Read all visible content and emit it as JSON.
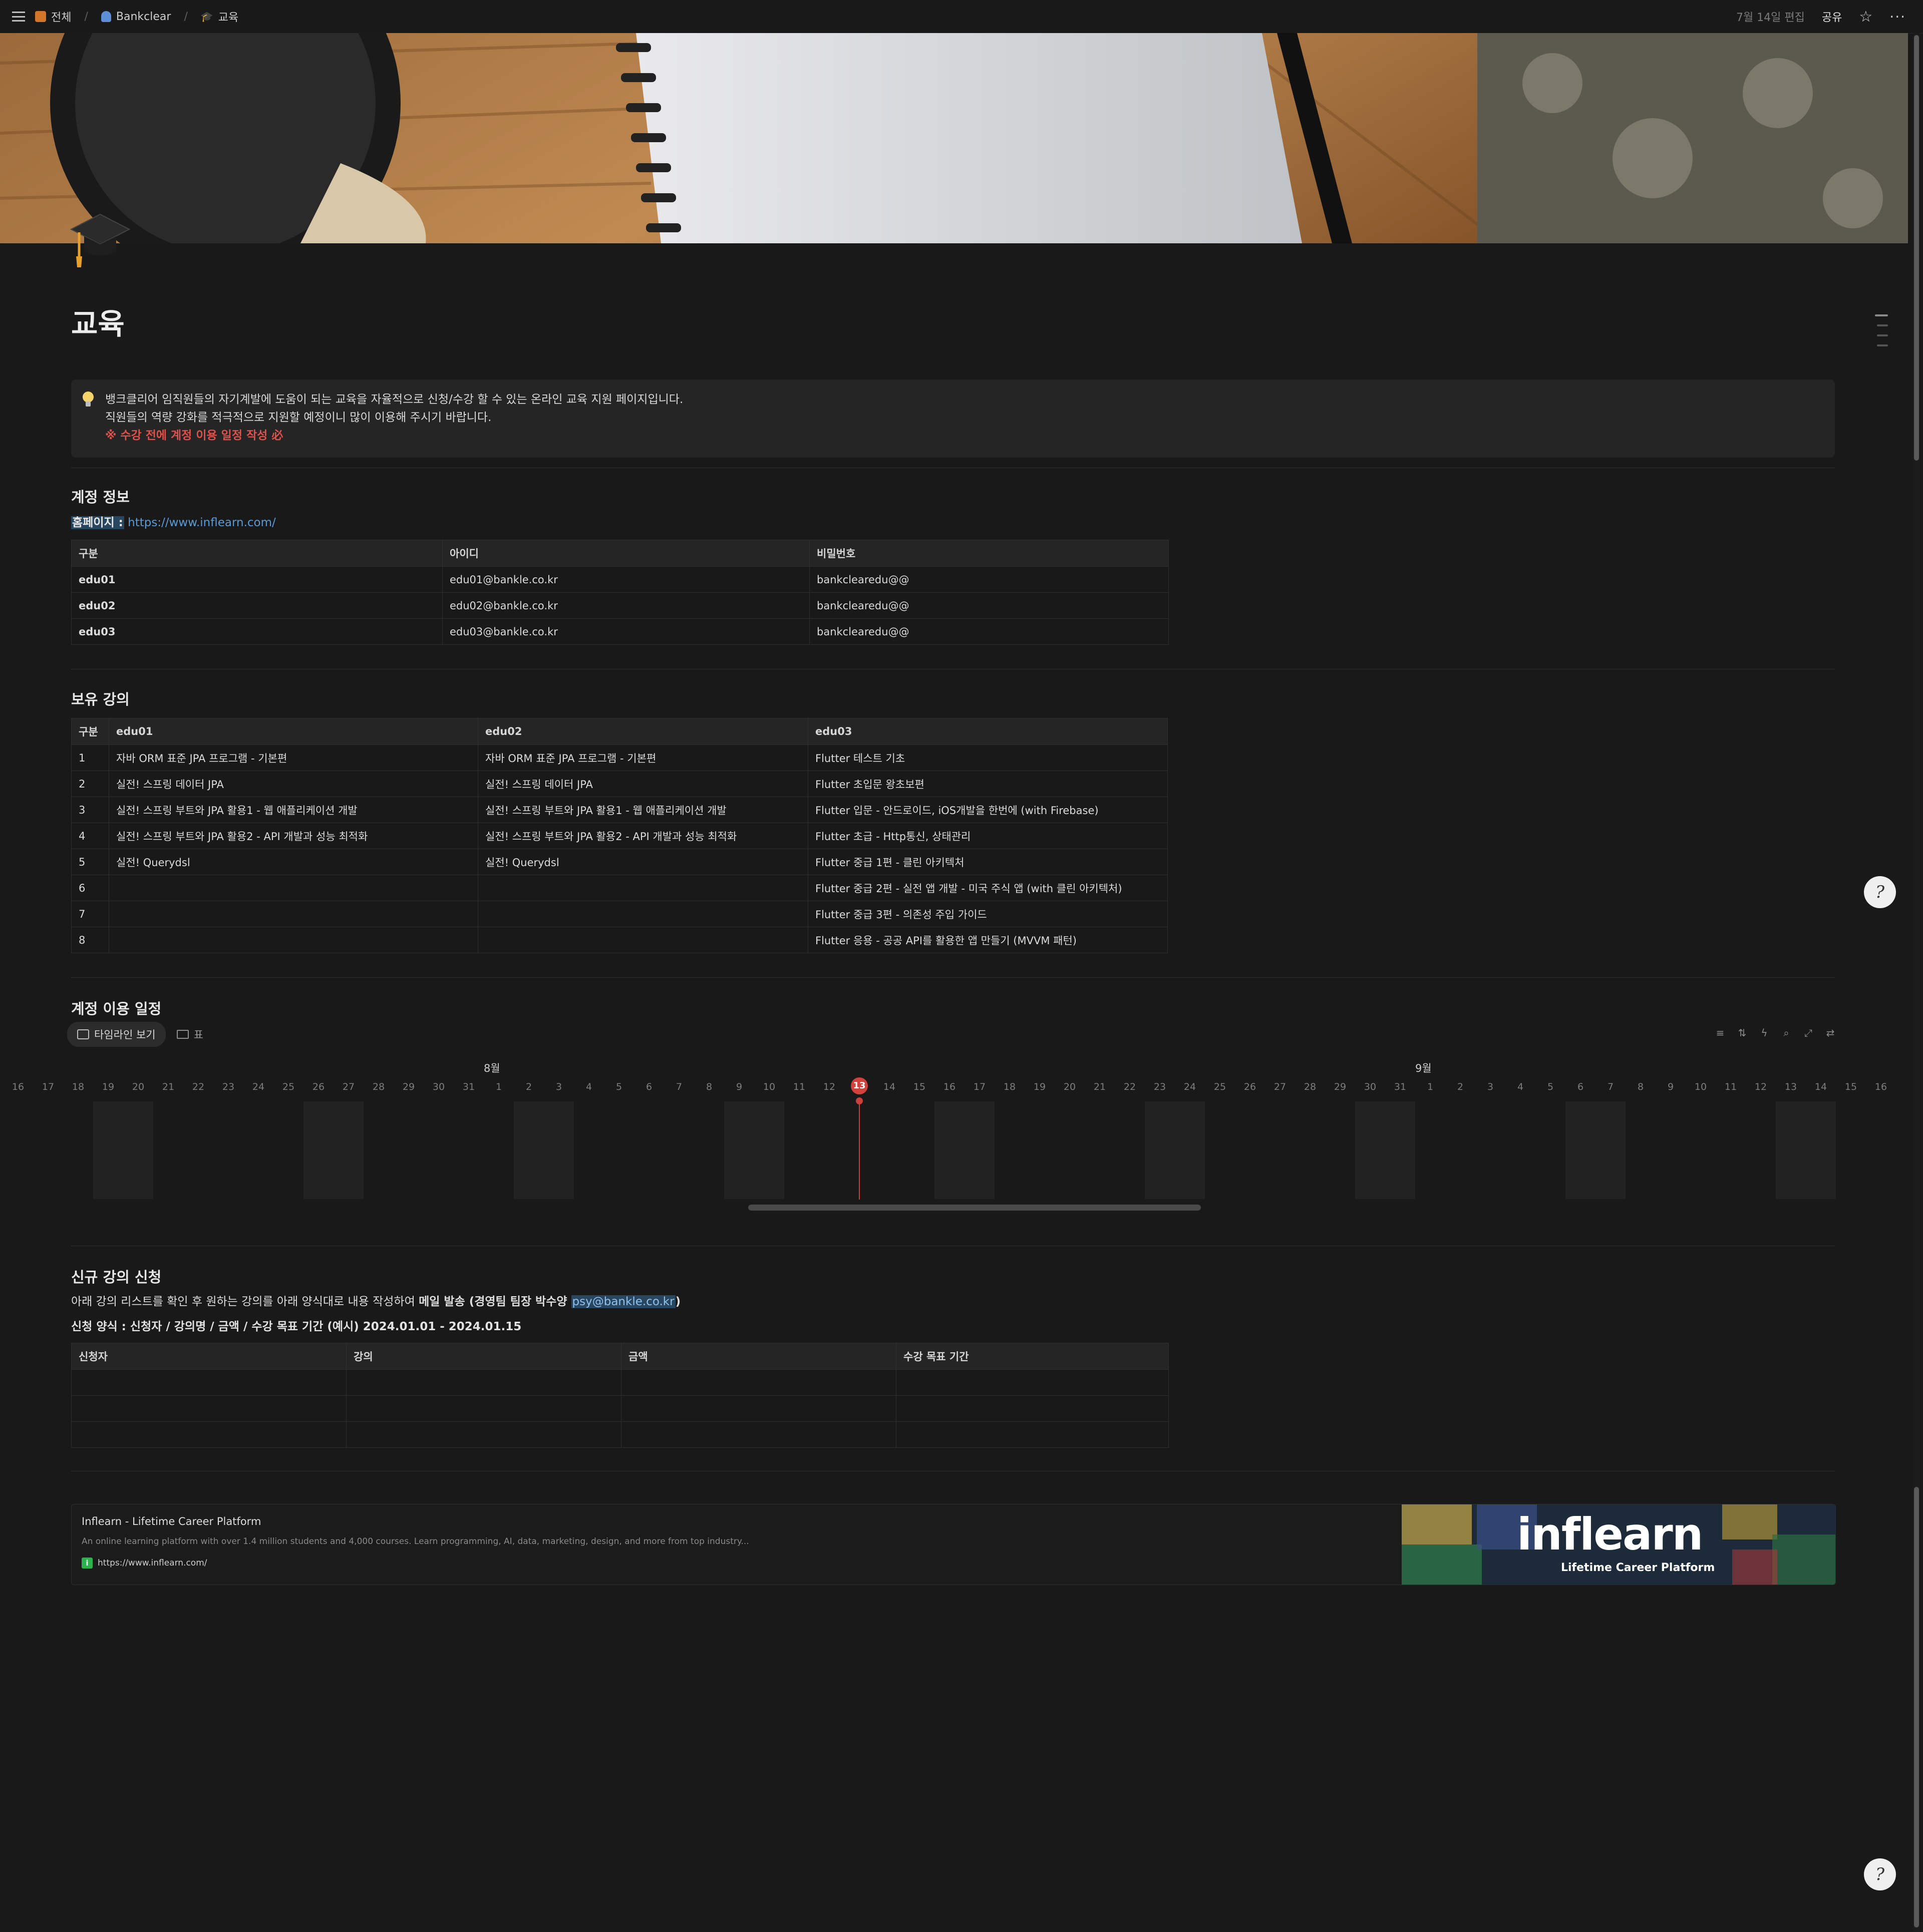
{
  "breadcrumb": [
    {
      "label": "전체"
    },
    {
      "label": "Bankclear"
    },
    {
      "label": "교육"
    }
  ],
  "topbar": {
    "edited": "7월 14일 편집",
    "share": "공유"
  },
  "page": {
    "title": "교육"
  },
  "callout": {
    "line1": "뱅크클리어 임직원들의 자기계발에 도움이 되는 교육을 자율적으로 신청/수강 할 수 있는  온라인 교육 지원 페이지입니다.",
    "line2": "직원들의 역량 강화를 적극적으로 지원할 예정이니 많이 이용해 주시기 바랍니다.",
    "warning": "※ 수강 전에 계정 이용 일정 작성 必"
  },
  "account": {
    "heading": "계정 정보",
    "homepage_label": "홈페이지 :",
    "homepage_url": "https://www.inflearn.com/",
    "columns": [
      "구분",
      "아이디",
      "비밀번호"
    ],
    "rows": [
      [
        "edu01",
        "edu01@bankle.co.kr",
        "bankclearedu@@"
      ],
      [
        "edu02",
        "edu02@bankle.co.kr",
        "bankclearedu@@"
      ],
      [
        "edu03",
        "edu03@bankle.co.kr",
        "bankclearedu@@"
      ]
    ]
  },
  "courses": {
    "heading": "보유 강의",
    "columns": [
      "구분",
      "edu01",
      "edu02",
      "edu03"
    ],
    "rows": [
      [
        "1",
        "자바 ORM 표준 JPA 프로그램 - 기본편",
        "자바 ORM 표준 JPA 프로그램 - 기본편",
        "Flutter 테스트 기초"
      ],
      [
        "2",
        "실전! 스프링 데이터 JPA",
        "실전! 스프링 데이터 JPA",
        "Flutter 초입문 왕초보편"
      ],
      [
        "3",
        "실전! 스프링 부트와  JPA 활용1 - 웹 애플리케이션 개발",
        "실전! 스프링 부트와  JPA 활용1 - 웹 애플리케이션 개발",
        "Flutter  입문 - 안드로이드, iOS개발을 한번에 (with Firebase)"
      ],
      [
        "4",
        "실전! 스프링 부트와 JPA 활용2 - API 개발과 성능 최적화",
        "실전! 스프링 부트와 JPA 활용2 - API 개발과 성능 최적화",
        "Flutter  초급 - Http통신, 상태관리"
      ],
      [
        "5",
        "실전! Querydsl",
        "실전! Querydsl",
        "Flutter 중급 1편 - 클린 아키텍처"
      ],
      [
        "6",
        "",
        "",
        "Flutter 중급 2편 - 실전 앱 개발 - 미국 주식 앱 (with 클린 아키텍처)"
      ],
      [
        "7",
        "",
        "",
        "Flutter 중급 3편 - 의존성 주입 가이드"
      ],
      [
        "8",
        "",
        "",
        "Flutter 응용 - 공공 API를 활용한 앱 만들기 (MVVM 패턴)"
      ]
    ]
  },
  "schedule": {
    "heading": "계정 이용 일정",
    "tabs": [
      {
        "label": "타임라인 보기"
      },
      {
        "label": "표"
      }
    ],
    "months": [
      "8월",
      "9월"
    ],
    "days": [
      "16",
      "17",
      "18",
      "19",
      "20",
      "21",
      "22",
      "23",
      "24",
      "25",
      "26",
      "27",
      "28",
      "29",
      "30",
      "31",
      "1",
      "2",
      "3",
      "4",
      "5",
      "6",
      "7",
      "8",
      "9",
      "10",
      "11",
      "12",
      "13",
      "14",
      "15",
      "16",
      "17",
      "18",
      "19",
      "20",
      "21",
      "22",
      "23",
      "24",
      "25",
      "26",
      "27",
      "28",
      "29",
      "30",
      "31",
      "1",
      "2",
      "3",
      "4",
      "5",
      "6",
      "7",
      "8",
      "9",
      "10",
      "11",
      "12",
      "13",
      "14",
      "15",
      "16"
    ],
    "today_index": 28,
    "accent": "#d2423d"
  },
  "request": {
    "heading": "신규 강의 신청",
    "desc_prefix": "아래 강의 리스트를 확인 후 원하는 강의를 아래 양식대로 내용 작성하여 ",
    "desc_bold": "메일 발송 (경영팀 팀장 박수양 ",
    "email": "psy@bankle.co.kr",
    "desc_close": ")",
    "format": "신청 양식 : 신청자 / 강의명 / 금액 / 수강 목표 기간 (예시) 2024.01.01 - 2024.01.15",
    "columns": [
      "신청자",
      "강의",
      "금액",
      "수강 목표 기간"
    ]
  },
  "bookmark": {
    "title": "Inflearn - Lifetime Career Platform",
    "description": "An online learning platform with over 1.4 million students and 4,000 courses. Learn programming, AI, data, marketing, design, and more from top industry...",
    "url": "https://www.inflearn.com/",
    "favicon": "i",
    "image_logo": "inflearn",
    "image_caption": "Lifetime Career Platform"
  },
  "help": {
    "glyph": "?"
  }
}
